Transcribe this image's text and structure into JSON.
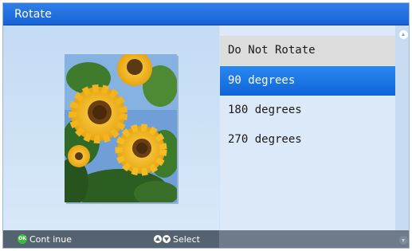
{
  "title_bar": {
    "title": "Rotate"
  },
  "menu": {
    "items": [
      {
        "label": "Do Not Rotate",
        "state": "current"
      },
      {
        "label": "90 degrees",
        "state": "selected"
      },
      {
        "label": "180 degrees",
        "state": "normal"
      },
      {
        "label": "270 degrees",
        "state": "normal"
      }
    ]
  },
  "preview": {
    "subject": "sunflowers photo",
    "icon": "photo-thumbnail"
  },
  "footer": {
    "continue_label": "Cont inue",
    "continue_button_icon": "ok-button-icon",
    "select_label": "Select",
    "select_icons": [
      "up-arrow-button-icon",
      "down-arrow-button-icon"
    ]
  },
  "colors": {
    "title_bar": "#1a6ae0",
    "selection": "#1a74e4",
    "panel": "#d6e6f8",
    "footer": "#55626f",
    "ok_green": "#3bbd3b"
  }
}
